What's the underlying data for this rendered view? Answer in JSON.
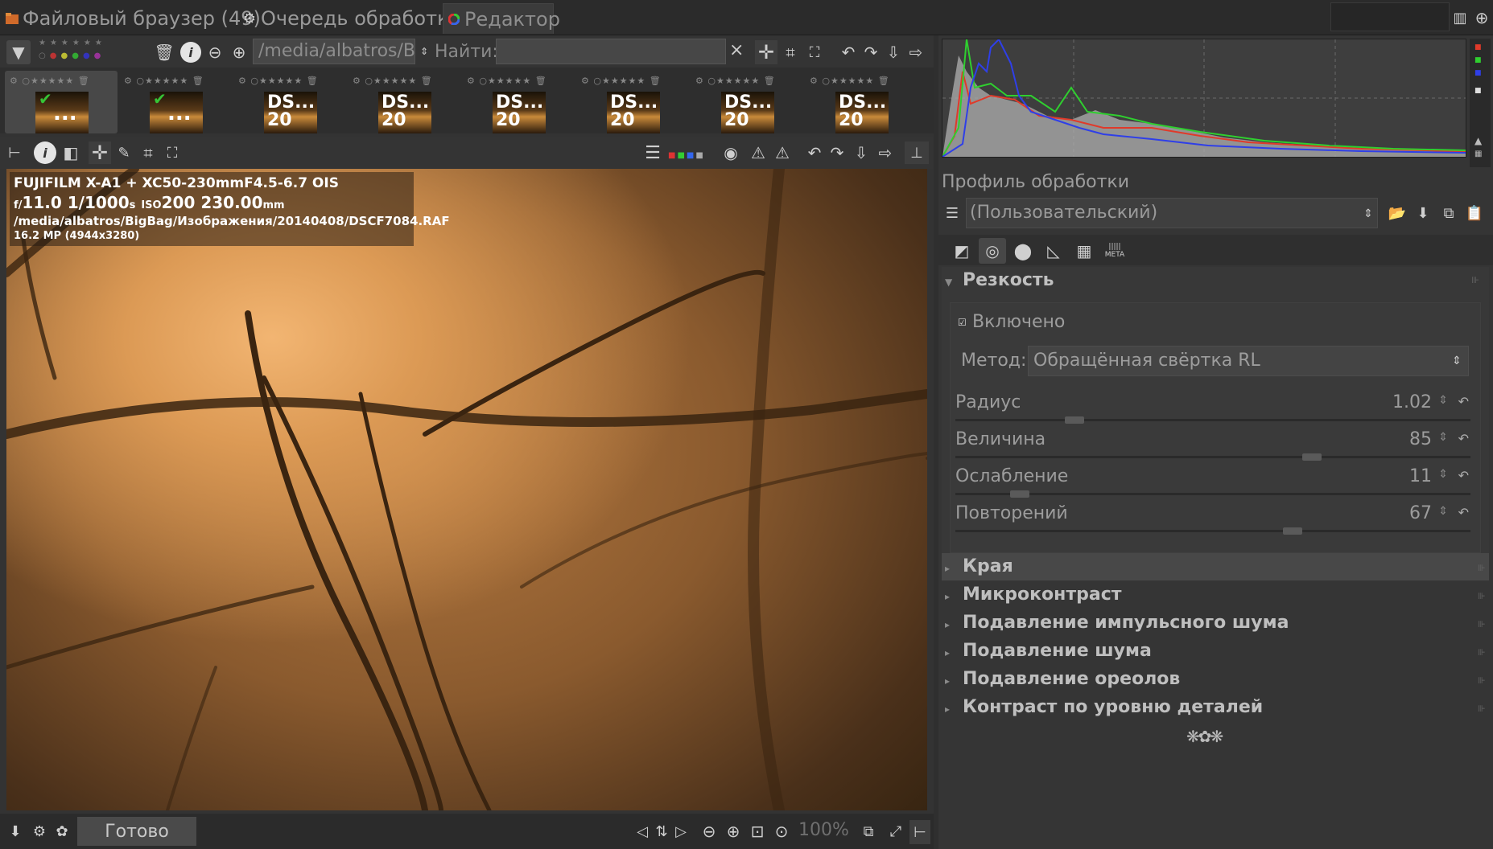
{
  "tabs": [
    {
      "label": "Файловый браузер (49)",
      "icon": "folder-icon"
    },
    {
      "label": "Очередь обработки",
      "icon": "gears-icon"
    },
    {
      "label": "Редактор",
      "icon": "color-wheel-icon"
    }
  ],
  "filebrowser": {
    "path": "/media/albatros/Bi",
    "find_label": "Найти:",
    "find_value": "",
    "clear_label": "×"
  },
  "filmstrip": [
    {
      "label": "...",
      "checked": true,
      "selected": true
    },
    {
      "label": "...",
      "checked": true,
      "selected": false
    },
    {
      "label": "DS...",
      "sub": "20",
      "checked": false,
      "selected": false
    },
    {
      "label": "DS...",
      "sub": "20",
      "checked": false,
      "selected": false
    },
    {
      "label": "DS...",
      "sub": "20",
      "checked": false,
      "selected": false
    },
    {
      "label": "DS...",
      "sub": "20",
      "checked": false,
      "selected": false
    },
    {
      "label": "DS...",
      "sub": "20",
      "checked": false,
      "selected": false
    },
    {
      "label": "DS...",
      "sub": "20",
      "checked": false,
      "selected": false
    }
  ],
  "exif": {
    "camera": "FUJIFILM X-A1 + XC50-230mmF4.5-6.7 OIS",
    "f_prefix": "f/",
    "aperture": "11.0",
    "shutter": "1/1000",
    "shutter_unit": "s",
    "iso_label": "ISO",
    "iso": "200",
    "focal": "230.00",
    "focal_unit": "mm",
    "file_path": "/media/albatros/BigBag/Изображения/20140408/DSCF7084.RAF",
    "size": "16.2 MP (4944x3280)"
  },
  "statusbar": {
    "ready": "Готово",
    "zoom": "100%"
  },
  "profile": {
    "title": "Профиль обработки",
    "value": "(Пользовательский)"
  },
  "tool_tabs": [
    "exposure-icon",
    "detail-icon",
    "color-icon",
    "transform-icon",
    "raw-icon",
    "meta-icon"
  ],
  "tool_tab_meta_label": "META",
  "sharpening": {
    "title": "Резкость",
    "enabled_label": "Включено",
    "method_label": "Метод:",
    "method_value": "Обращённая свёртка RL",
    "params": [
      {
        "label": "Радиус",
        "value": "1.02",
        "fraction": 0.22
      },
      {
        "label": "Величина",
        "value": "85",
        "fraction": 0.7
      },
      {
        "label": "Ослабление",
        "value": "11",
        "fraction": 0.11
      },
      {
        "label": "Повторений",
        "value": "67",
        "fraction": 0.66
      }
    ]
  },
  "sections": [
    {
      "title": "Края",
      "highlighted": true
    },
    {
      "title": "Микроконтраст",
      "highlighted": false
    },
    {
      "title": "Подавление импульсного шума",
      "highlighted": false
    },
    {
      "title": "Подавление шума",
      "highlighted": false
    },
    {
      "title": "Подавление ореолов",
      "highlighted": false
    },
    {
      "title": "Контраст по уровню деталей",
      "highlighted": false
    }
  ],
  "colors": {
    "histogram_red": "#e03a2a",
    "histogram_green": "#2fcf2f",
    "histogram_blue": "#2f3fe8",
    "accent_check": "#36c436"
  }
}
